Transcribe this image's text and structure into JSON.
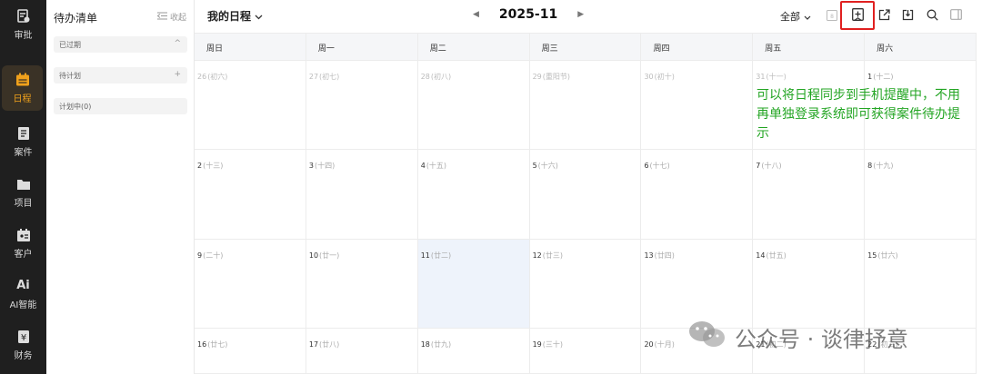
{
  "nav": {
    "items": [
      {
        "label": "审批",
        "icon": "approval-icon"
      },
      {
        "label": "日程",
        "icon": "calendar-icon",
        "active": true
      },
      {
        "label": "案件",
        "icon": "case-icon"
      },
      {
        "label": "项目",
        "icon": "folder-icon"
      },
      {
        "label": "客户",
        "icon": "client-icon"
      },
      {
        "label": "AI智能",
        "icon": "ai-icon"
      },
      {
        "label": "财务",
        "icon": "finance-icon"
      }
    ]
  },
  "todo": {
    "title": "待办清单",
    "collapse_label": "收起",
    "groups": [
      {
        "label": "已过期",
        "right": "^"
      },
      {
        "label": "待计划",
        "right": "+"
      },
      {
        "label": "计划中(0)",
        "right": ""
      }
    ]
  },
  "header": {
    "my_calendar": "我的日程",
    "prev_icon": "◀",
    "month": "2025-11",
    "next_icon": "▶",
    "filter": "全部",
    "tools": [
      "today-icon",
      "sync-to-phone-icon",
      "export-icon",
      "import-icon",
      "search-icon",
      "panel-icon"
    ]
  },
  "weekdays": [
    "周日",
    "周一",
    "周二",
    "周三",
    "周四",
    "周五",
    "周六"
  ],
  "weeks": [
    [
      {
        "d": "26",
        "l": "(初六)",
        "o": true
      },
      {
        "d": "27",
        "l": "(初七)",
        "o": true
      },
      {
        "d": "28",
        "l": "(初八)",
        "o": true
      },
      {
        "d": "29",
        "l": "(重阳节)",
        "o": true
      },
      {
        "d": "30",
        "l": "(初十)",
        "o": true
      },
      {
        "d": "31",
        "l": "(十一)",
        "o": true
      },
      {
        "d": "1",
        "l": "(十二)"
      }
    ],
    [
      {
        "d": "2",
        "l": "(十三)"
      },
      {
        "d": "3",
        "l": "(十四)"
      },
      {
        "d": "4",
        "l": "(十五)"
      },
      {
        "d": "5",
        "l": "(十六)"
      },
      {
        "d": "6",
        "l": "(十七)"
      },
      {
        "d": "7",
        "l": "(十八)"
      },
      {
        "d": "8",
        "l": "(十九)"
      }
    ],
    [
      {
        "d": "9",
        "l": "(二十)"
      },
      {
        "d": "10",
        "l": "(廿一)"
      },
      {
        "d": "11",
        "l": "(廿二)",
        "today": true
      },
      {
        "d": "12",
        "l": "(廿三)"
      },
      {
        "d": "13",
        "l": "(廿四)"
      },
      {
        "d": "14",
        "l": "(廿五)"
      },
      {
        "d": "15",
        "l": "(廿六)"
      }
    ],
    [
      {
        "d": "16",
        "l": "(廿七)"
      },
      {
        "d": "17",
        "l": "(廿八)"
      },
      {
        "d": "18",
        "l": "(廿九)"
      },
      {
        "d": "19",
        "l": "(三十)"
      },
      {
        "d": "20",
        "l": "(十月)"
      },
      {
        "d": "21",
        "l": "(初二)"
      },
      {
        "d": "22",
        "l": "(初三)"
      }
    ]
  ],
  "hint": "可以将日程同步到手机提醒中，不用再单独登录系统即可获得案件待办提示",
  "watermark": "公众号 · 谈律抒意",
  "colors": {
    "accent": "#f0a11c",
    "highlight": "#e02020",
    "hint": "#23a523"
  }
}
